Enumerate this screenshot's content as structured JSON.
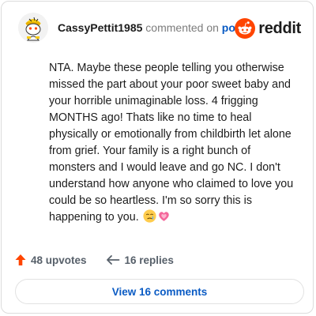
{
  "header": {
    "author": "CassyPettit1985",
    "action_text": "commented on",
    "post_link": "post",
    "brand": "reddit"
  },
  "comment": {
    "text": "NTA. Maybe these people telling you otherwise missed the part about your poor sweet baby and your horrible unimaginable loss. 4 frigging MONTHS ago! Thats like no time to heal physically or emotionally from childbirth let alone from grief. Your family is a right bunch of monsters and I would leave and go NC. I don't understand how anyone who claimed to love you could be so heartless. I'm so sorry this is happening to you.",
    "emojis": [
      "crying-face-emoji",
      "growing-heart-emoji"
    ]
  },
  "stats": {
    "upvotes": "48 upvotes",
    "replies": "16 replies"
  },
  "actions": {
    "view_comments": "View 16 comments"
  },
  "colors": {
    "reddit_orange": "#FF4500",
    "link_blue": "#0a5bc4",
    "upvote_orange": "#ff4500"
  },
  "icons": {
    "avatar": "snoo-avatar-with-yellow-hat",
    "brand_logo": "reddit-snoo-icon",
    "upvote": "upvote-arrow-icon",
    "reply": "reply-arrow-icon"
  }
}
